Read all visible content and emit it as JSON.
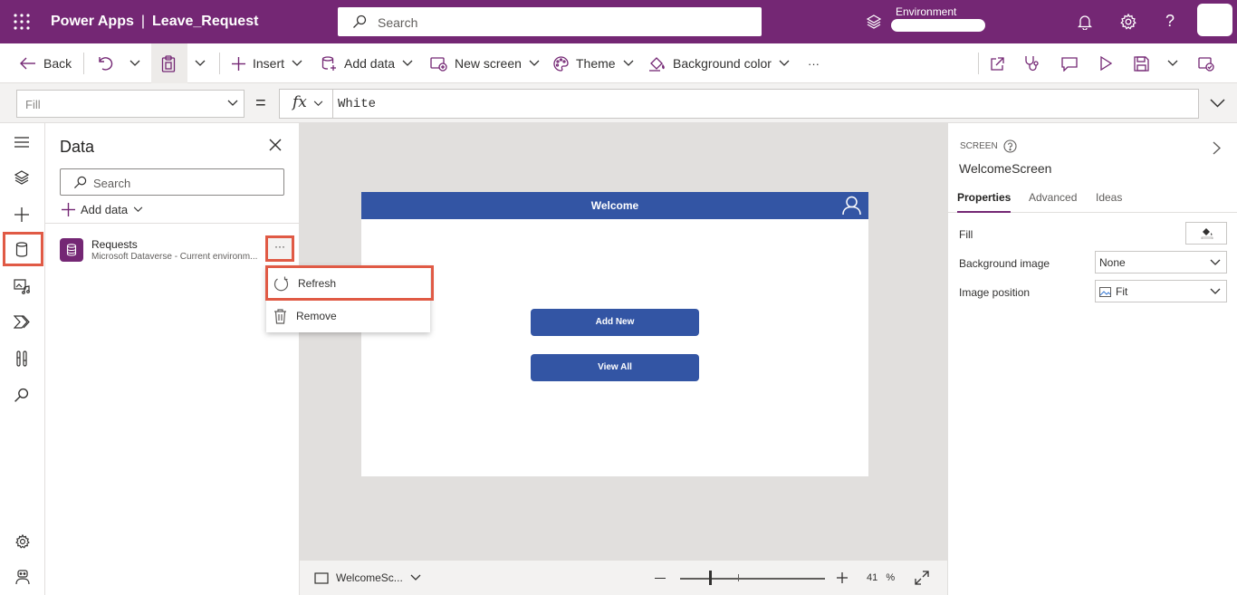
{
  "header": {
    "app_name": "Power Apps",
    "separator": "|",
    "app_file": "Leave_Request",
    "search_placeholder": "Search",
    "environment_label": "Environment"
  },
  "toolbar": {
    "back": "Back",
    "insert": "Insert",
    "add_data": "Add data",
    "new_screen": "New screen",
    "theme": "Theme",
    "background_color": "Background color",
    "more": "···"
  },
  "formula_bar": {
    "property": "Fill",
    "equals": "=",
    "fx": "fx",
    "formula": "White"
  },
  "data_pane": {
    "title": "Data",
    "search_placeholder": "Search",
    "add_data": "Add data",
    "source": {
      "name": "Requests",
      "subtitle": "Microsoft Dataverse - Current environm...",
      "more": "···"
    },
    "context_menu": [
      {
        "label": "Refresh",
        "icon": "refresh-icon"
      },
      {
        "label": "Remove",
        "icon": "trash-icon"
      }
    ]
  },
  "canvas": {
    "header_title": "Welcome",
    "buttons": [
      "Add New",
      "View All"
    ],
    "screen_selector": "WelcomeSc...",
    "zoom": "41",
    "zoom_unit": "%",
    "zoom_fraction": 0.41
  },
  "properties": {
    "kind": "SCREEN",
    "name": "WelcomeScreen",
    "tabs": [
      "Properties",
      "Advanced",
      "Ideas"
    ],
    "fill_label": "Fill",
    "background_image_label": "Background image",
    "background_image_value": "None",
    "image_position_label": "Image position",
    "image_position_value": "Fit"
  },
  "colors": {
    "brand": "#742774",
    "screen_accent": "#3355a4",
    "highlight": "#e05a45"
  }
}
